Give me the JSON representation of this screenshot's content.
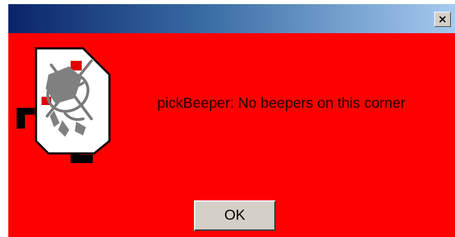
{
  "dialog": {
    "close_label": "×",
    "icon": "karel-error-robot-icon",
    "message": "pickBeeper: No beepers on this corner",
    "ok_label": "OK",
    "background_color": "#ff0000",
    "titlebar_gradient": [
      "#0a246a",
      "#a6caf0"
    ]
  }
}
